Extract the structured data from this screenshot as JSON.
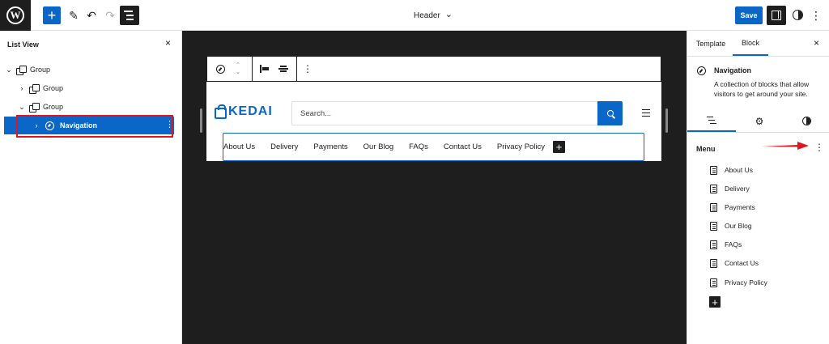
{
  "topbar": {
    "logo": "W",
    "add": "+",
    "edit": "✎",
    "undo": "↶",
    "redo": "↷",
    "title": "Header",
    "title_chevron": "⌄",
    "save_label": "Save",
    "more": "⋮"
  },
  "list_view": {
    "title": "List View",
    "close": "×",
    "items": [
      {
        "label": "Group",
        "chevron": "⌄"
      },
      {
        "label": "Group",
        "chevron": "›"
      },
      {
        "label": "Group",
        "chevron": "⌄"
      },
      {
        "label": "Navigation",
        "chevron": "›",
        "more": "⋮"
      }
    ]
  },
  "block_toolbar": {
    "up": "⌃",
    "down": "⌄",
    "more": "⋮"
  },
  "site_header": {
    "logo_text": "KEDAI",
    "search_placeholder": "Search...",
    "nav_links": [
      "About Us",
      "Delivery",
      "Payments",
      "Our Blog",
      "FAQs",
      "Contact Us",
      "Privacy Policy"
    ],
    "nav_add": "+"
  },
  "right_panel": {
    "tabs": [
      "Template",
      "Block"
    ],
    "close": "×",
    "block_name": "Navigation",
    "block_description": "A collection of blocks that allow visitors to get around your site.",
    "gear": "⚙",
    "menu_label": "Menu",
    "menu_more": "⋮",
    "menu_items": [
      "About Us",
      "Delivery",
      "Payments",
      "Our Blog",
      "FAQs",
      "Contact Us",
      "Privacy Policy"
    ],
    "menu_add": "+"
  },
  "colors": {
    "accent": "#0a67c7",
    "highlight": "#e0161c",
    "canvas": "#1e1e1e"
  }
}
